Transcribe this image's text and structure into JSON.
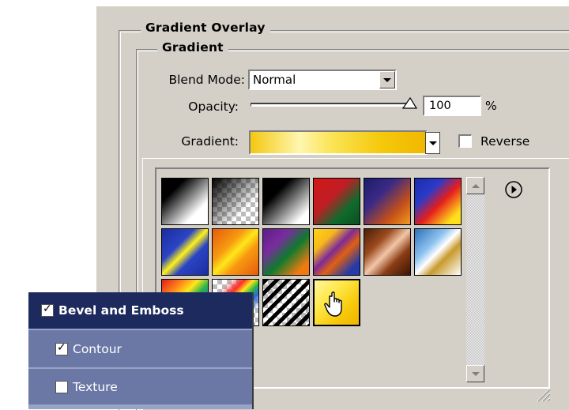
{
  "dialog": {
    "section_title": "Gradient Overlay",
    "group_title": "Gradient"
  },
  "blend_mode": {
    "label": "Blend Mode:",
    "value": "Normal"
  },
  "opacity": {
    "label": "Opacity:",
    "value": "100",
    "unit": "%",
    "slider_value_percent": 100
  },
  "gradient": {
    "label": "Gradient:",
    "preview_colors": [
      "#f4c810",
      "#fff6b0",
      "#fbe55a",
      "#f0b800"
    ],
    "reverse_label": "Reverse",
    "reverse_checked": false
  },
  "picker": {
    "menu_icon": "play-circle-icon",
    "presets": [
      {
        "name": "black-to-white"
      },
      {
        "name": "black-to-transparent"
      },
      {
        "name": "black-to-white-2"
      },
      {
        "name": "red-green"
      },
      {
        "name": "violet-orange"
      },
      {
        "name": "blue-red-yellow"
      },
      {
        "name": "blue-yellow-blue"
      },
      {
        "name": "orange-yellow-orange"
      },
      {
        "name": "violet-green-orange"
      },
      {
        "name": "yellow-violet-orange-blue"
      },
      {
        "name": "copper"
      },
      {
        "name": "chrome"
      },
      {
        "name": "spectrum"
      },
      {
        "name": "transparent-rainbow"
      },
      {
        "name": "transparent-stripes"
      },
      {
        "name": "yellow-selected"
      }
    ],
    "cursor_icon": "hand-pointer-icon"
  },
  "styles": {
    "items": [
      {
        "label": "Bevel and Emboss",
        "checked": true
      },
      {
        "label": "Contour",
        "checked": true
      },
      {
        "label": "Texture",
        "checked": false
      }
    ]
  },
  "colors": {
    "dialog_bg": "#d4d0c8",
    "styles_header_bg": "#1c2a5e",
    "styles_sub_bg": "#6b78a6"
  }
}
